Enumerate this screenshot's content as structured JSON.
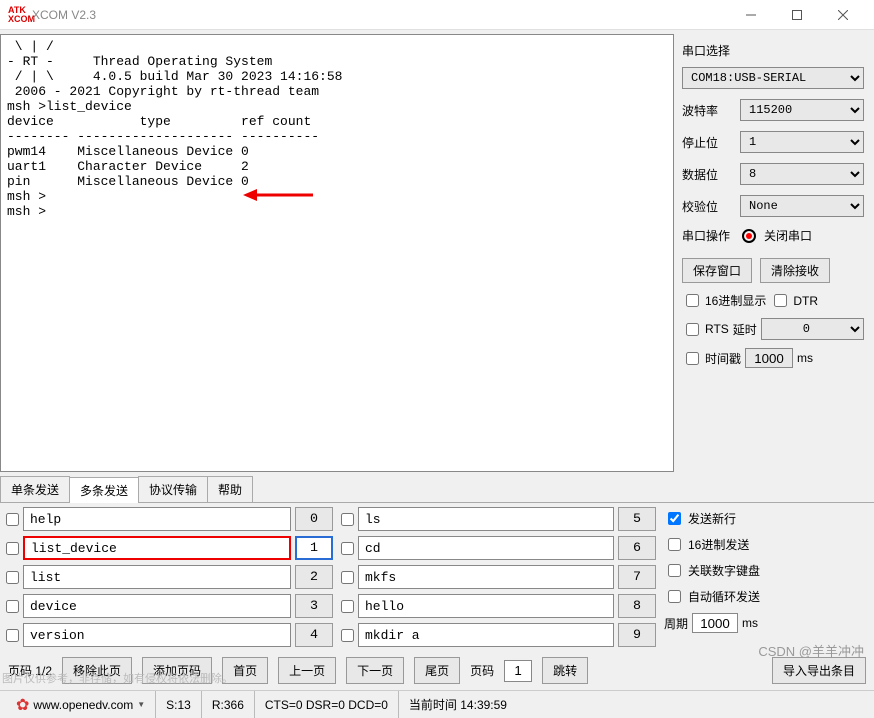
{
  "title": "XCOM V2.3",
  "terminal_text": " \\ | /\n- RT -     Thread Operating System\n / | \\     4.0.5 build Mar 30 2023 14:16:58\n 2006 - 2021 Copyright by rt-thread team\nmsh >list_device\ndevice           type         ref count\n-------- -------------------- ----------\npwm14    Miscellaneous Device 0\nuart1    Character Device     2\npin      Miscellaneous Device 0\nmsh >\nmsh >",
  "side": {
    "title": "串口选择",
    "port": "COM18:USB-SERIAL",
    "baud_label": "波特率",
    "baud": "115200",
    "stop_label": "停止位",
    "stop": "1",
    "data_label": "数据位",
    "data": "8",
    "parity_label": "校验位",
    "parity": "None",
    "op_label": "串口操作",
    "close_btn": "关闭串口",
    "save_btn": "保存窗口",
    "clear_btn": "清除接收",
    "hex_disp": "16进制显示",
    "dtr": "DTR",
    "rts": "RTS",
    "delay_label": "延时",
    "delay_val": "0",
    "timestamp": "时间戳",
    "ts_val": "1000",
    "ms": "ms"
  },
  "tabs": [
    "单条发送",
    "多条发送",
    "协议传输",
    "帮助"
  ],
  "active_tab": 1,
  "cmds_left": [
    {
      "text": "help",
      "num": "0"
    },
    {
      "text": "list_device",
      "num": "1",
      "hl": true,
      "sel": true
    },
    {
      "text": "list",
      "num": "2"
    },
    {
      "text": "device",
      "num": "3"
    },
    {
      "text": "version",
      "num": "4"
    }
  ],
  "cmds_right": [
    {
      "text": "ls",
      "num": "5"
    },
    {
      "text": "cd",
      "num": "6"
    },
    {
      "text": "mkfs",
      "num": "7"
    },
    {
      "text": "hello",
      "num": "8"
    },
    {
      "text": "mkdir a",
      "num": "9"
    }
  ],
  "opts": {
    "send_newline": "发送新行",
    "hex_send": "16进制发送",
    "numpad": "关联数字键盘",
    "auto_loop": "自动循环发送",
    "period_label": "周期",
    "period_val": "1000",
    "ms": "ms"
  },
  "nav": {
    "page_label": "页码 1/2",
    "remove": "移除此页",
    "add": "添加页码",
    "home": "首页",
    "prev": "上一页",
    "next": "下一页",
    "last": "尾页",
    "page_lbl": "页码",
    "page_val": "1",
    "jump": "跳转",
    "import": "导入导出条目"
  },
  "status": {
    "site": "www.openedv.com",
    "s": "S:13",
    "r": "R:366",
    "sig": "CTS=0 DSR=0 DCD=0",
    "time": "当前时间 14:39:59"
  },
  "watermark": "CSDN @羊羊冲冲",
  "footnote": "图片仅供参考，非存储，如有侵权将依法删除。"
}
